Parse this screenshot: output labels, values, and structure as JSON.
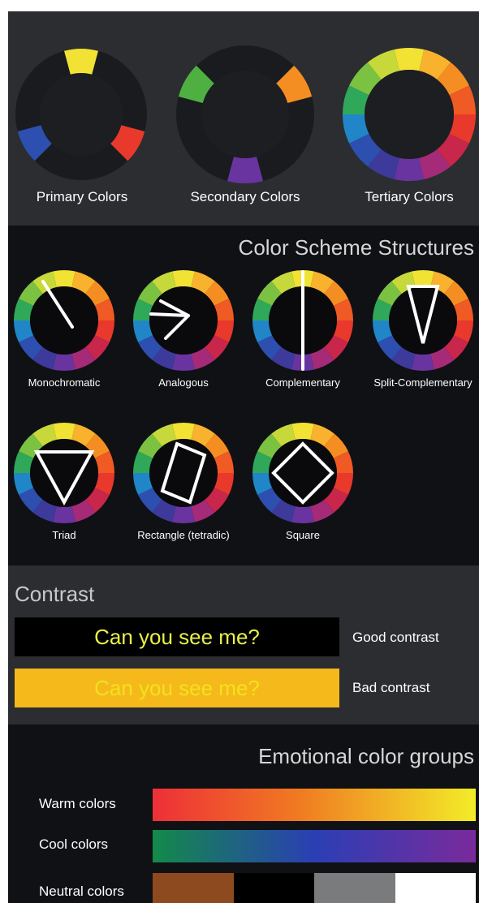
{
  "wheels": {
    "primary_label": "Primary Colors",
    "secondary_label": "Secondary Colors",
    "tertiary_label": "Tertiary Colors"
  },
  "schemes": {
    "title": "Color Scheme Structures",
    "items": [
      {
        "label": "Monochromatic"
      },
      {
        "label": "Analogous"
      },
      {
        "label": "Complementary"
      },
      {
        "label": "Split-Complementary"
      },
      {
        "label": "Triad"
      },
      {
        "label": "Rectangle (tetradic)"
      },
      {
        "label": "Square"
      }
    ]
  },
  "contrast": {
    "title": "Contrast",
    "good": {
      "sample_text": "Can you see me?",
      "note": "Good contrast",
      "background": "#000000",
      "text_color": "#e8f04a"
    },
    "bad": {
      "sample_text": "Can you see me?",
      "note": "Bad contrast",
      "background": "#f5b91c",
      "text_color": "#f1e21c"
    }
  },
  "emotional": {
    "title": "Emotional color groups",
    "warm": {
      "label": "Warm colors",
      "colors": [
        "#ee2f38",
        "#f07a22",
        "#f2ec28"
      ]
    },
    "cool": {
      "label": "Cool colors",
      "colors": [
        "#138a4a",
        "#2a3fb4",
        "#7a2a9c"
      ]
    },
    "neutral": {
      "label": "Neutral colors",
      "colors": [
        "#8c4a1e",
        "#000000",
        "#7a7b7d",
        "#ffffff"
      ]
    }
  },
  "wheel_colors": [
    "#f2e234",
    "#f8b22e",
    "#f58e22",
    "#f05a24",
    "#e8392c",
    "#c8264a",
    "#a52a78",
    "#6a34a0",
    "#3d3a9c",
    "#2d4fb0",
    "#2086c8",
    "#2fa85a",
    "#7cc242",
    "#c7d93a"
  ],
  "colors": {
    "dark_panel": "#2b2d30",
    "black_panel": "#101114",
    "ring_empty": "#1a1b1e"
  }
}
